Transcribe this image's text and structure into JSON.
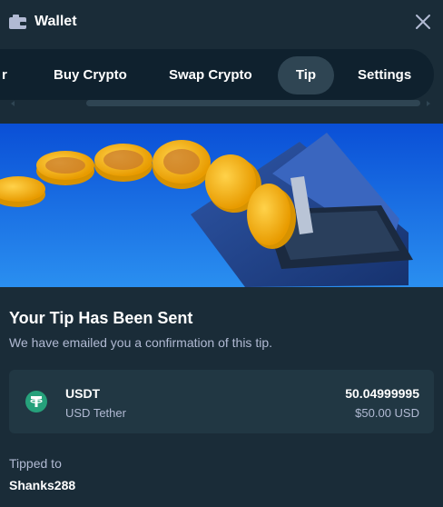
{
  "header": {
    "title": "Wallet"
  },
  "tabs": {
    "items": [
      {
        "label": "Buy Crypto",
        "active": false
      },
      {
        "label": "Swap Crypto",
        "active": false
      },
      {
        "label": "Tip",
        "active": true
      },
      {
        "label": "Settings",
        "active": false
      }
    ]
  },
  "confirmation": {
    "title": "Your Tip Has Been Sent",
    "subtitle": "We have emailed you a confirmation of this tip."
  },
  "currency": {
    "code": "USDT",
    "name": "USD Tether",
    "amount": "50.04999995",
    "usd_value": "$50.00 USD",
    "icon": "tether-icon",
    "icon_color": "#26a17b"
  },
  "recipient": {
    "label": "Tipped to",
    "username": "Shanks288"
  },
  "colors": {
    "background": "#1a2c38",
    "tab_bar": "#0f212e",
    "active_tab": "#2f4553",
    "card": "#213743",
    "muted_text": "#b1bad3"
  }
}
